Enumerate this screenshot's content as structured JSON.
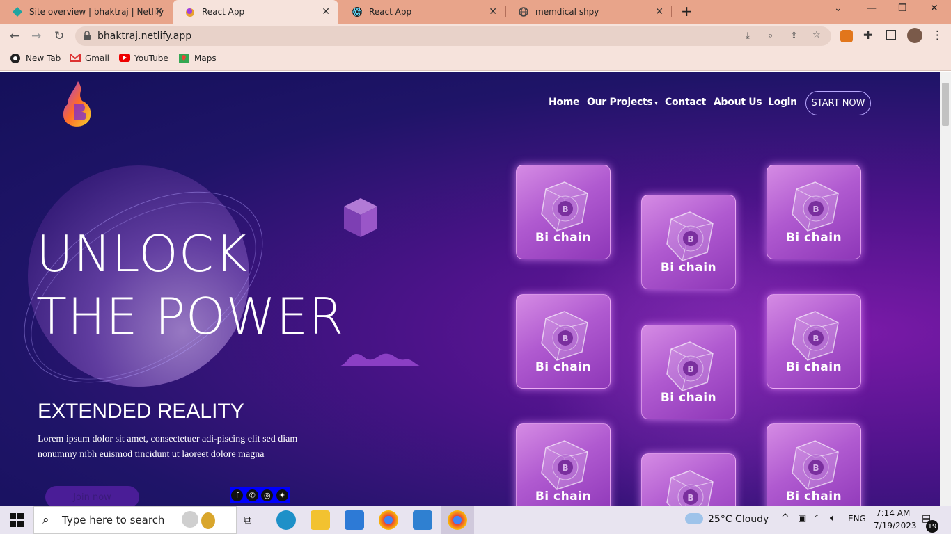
{
  "browser": {
    "tabs": [
      {
        "title": "Site overview | bhaktraj | Netlify"
      },
      {
        "title": "React App"
      },
      {
        "title": "React App"
      },
      {
        "title": "memdical shpy"
      }
    ],
    "address": "bhaktraj.netlify.app",
    "bookmarks": [
      "New Tab",
      "Gmail",
      "YouTube",
      "Maps"
    ]
  },
  "site": {
    "nav": [
      "Home",
      "Our Projects",
      "Contact",
      "About Us",
      "Login"
    ],
    "start_label": "START NOW",
    "hero_line1": "UNLOCK",
    "hero_line2": "THE POWER",
    "subtitle": "EXTENDED REALITY",
    "lorem": "Lorem ipsum dolor sit amet, consectetuer adi-piscing elit sed diam nonummy nibh euismod tincidunt ut laoreet dolore magna",
    "join_label": "Join now",
    "card_label": "Bi chain"
  },
  "taskbar": {
    "search_placeholder": "Type here to search",
    "weather": "25°C  Cloudy",
    "lang": "ENG",
    "time": "7:14 AM",
    "date": "7/19/2023",
    "notifications": "19"
  }
}
